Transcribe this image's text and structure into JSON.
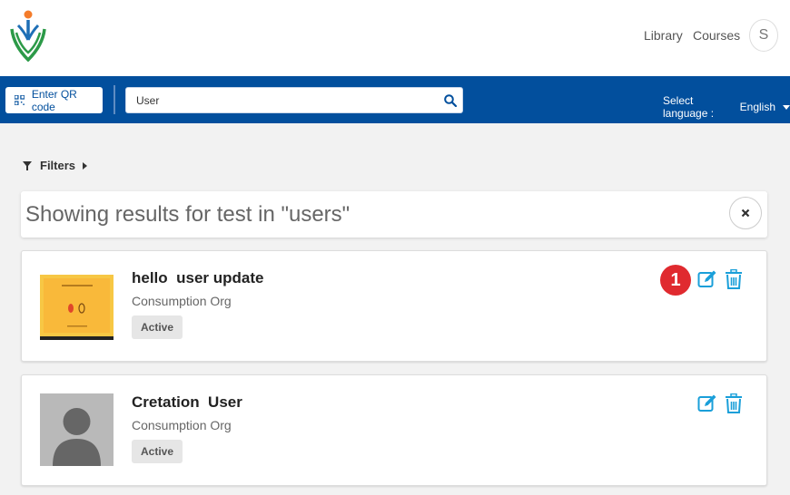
{
  "header": {
    "logo_icon": "diksha-logo-icon",
    "nav": {
      "library": "Library",
      "courses": "Courses"
    },
    "avatar_initial": "S"
  },
  "toolbar": {
    "qr_label": "Enter QR code",
    "qr_icon": "qr-code-icon",
    "search_value": "User",
    "search_icon": "search-icon",
    "language_label": "Select language :",
    "language_value": "English",
    "colors": {
      "bar": "#024f9d"
    }
  },
  "filters": {
    "label": "Filters",
    "icon": "funnel-icon"
  },
  "results": {
    "text": "Showing results for test in \"users\"",
    "close_icon": "close-icon"
  },
  "cards": [
    {
      "title": "hello  user update",
      "org": "Consumption Org",
      "status": "Active",
      "thumb_icon": "certificate-thumbnail",
      "step_badge": "1",
      "actions": [
        "edit-icon",
        "trash-icon"
      ]
    },
    {
      "title": "Cretation  User",
      "org": "Consumption Org",
      "status": "Active",
      "thumb_icon": "default-user-avatar",
      "actions": [
        "edit-icon",
        "trash-icon"
      ]
    }
  ],
  "colors": {
    "accent": "#1a9fd9",
    "step_badge": "#e02a2f"
  }
}
